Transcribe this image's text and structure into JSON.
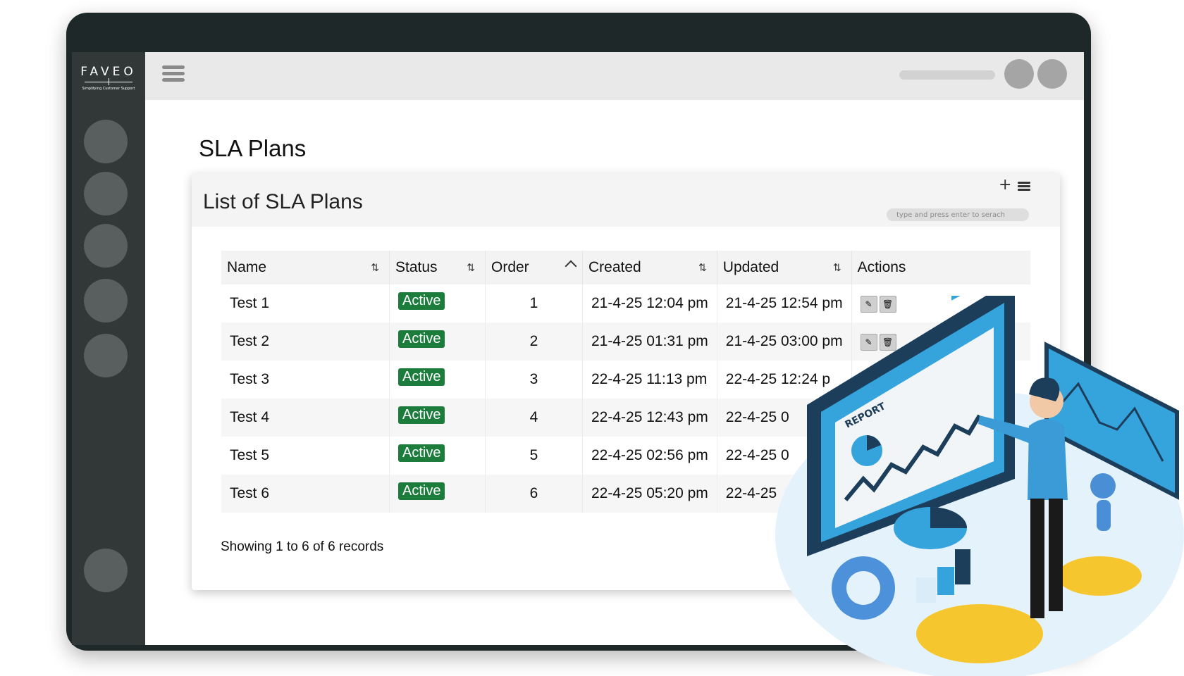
{
  "brand": {
    "name": "FAVEO",
    "tagline": "Simplifying Customer Support"
  },
  "page": {
    "title": "SLA Plans"
  },
  "card": {
    "title": "List of SLA Plans",
    "add_icon": "plus-icon",
    "menu_icon": "list-menu-icon",
    "search_placeholder": "type and press enter to serach"
  },
  "table": {
    "columns": [
      {
        "label": "Name",
        "sort_icon": "sort-both-icon"
      },
      {
        "label": "Status",
        "sort_icon": "sort-both-icon"
      },
      {
        "label": "Order",
        "sort_icon": "sort-ascending-icon"
      },
      {
        "label": "Created",
        "sort_icon": "sort-both-icon"
      },
      {
        "label": "Updated",
        "sort_icon": "sort-both-icon"
      },
      {
        "label": "Actions"
      }
    ],
    "rows": [
      {
        "name": "Test 1",
        "status": "Active",
        "order": "1",
        "created": "21-4-25 12:04 pm",
        "updated": "21-4-25 12:54 pm"
      },
      {
        "name": "Test 2",
        "status": "Active",
        "order": "2",
        "created": "21-4-25 01:31 pm",
        "updated": "21-4-25 03:00 pm"
      },
      {
        "name": "Test 3",
        "status": "Active",
        "order": "3",
        "created": "22-4-25 11:13 pm",
        "updated": "22-4-25 12:24 p"
      },
      {
        "name": "Test 4",
        "status": "Active",
        "order": "4",
        "created": "22-4-25 12:43 pm",
        "updated": "22-4-25 0"
      },
      {
        "name": "Test 5",
        "status": "Active",
        "order": "5",
        "created": "22-4-25 02:56 pm",
        "updated": "22-4-25 0"
      },
      {
        "name": "Test 6",
        "status": "Active",
        "order": "6",
        "created": "22-4-25 05:20 pm",
        "updated": "22-4-25"
      }
    ],
    "action_icons": [
      "edit-icon",
      "delete-icon"
    ]
  },
  "footer": {
    "records_text": "Showing 1 to 6 of 6 records"
  },
  "illustration": {
    "report_label": "REPORT"
  },
  "colors": {
    "frame": "#1f2828",
    "sidebar": "#323838",
    "topbar": "#e9e9e9",
    "status_active": "#1b7c3c",
    "accent_blue": "#35a3dc"
  }
}
